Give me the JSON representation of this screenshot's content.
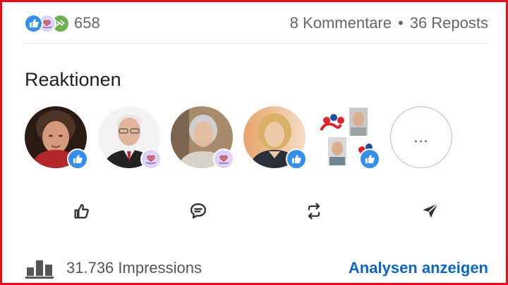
{
  "reactions": {
    "icons": [
      "like-icon",
      "love-icon",
      "support-icon"
    ],
    "count": "658"
  },
  "engagement": {
    "comments": "8 Kommentare",
    "separator": "•",
    "reposts": "36 Reposts"
  },
  "section_title": "Reaktionen",
  "reactors": [
    {
      "reaction": "like"
    },
    {
      "reaction": "love"
    },
    {
      "reaction": "love"
    },
    {
      "reaction": "like"
    },
    {
      "reaction": "like"
    }
  ],
  "more_label": "...",
  "actions": [
    "like-icon",
    "comment-icon",
    "repost-icon",
    "send-icon"
  ],
  "footer": {
    "impressions": "31.736 Impressions",
    "analytics_link": "Analysen anzeigen"
  },
  "colors": {
    "frame": "#e3101c",
    "like": "#378fe9",
    "love_bg": "#dfd2f5",
    "support": "#6dae4f",
    "link": "#0a66c2"
  }
}
